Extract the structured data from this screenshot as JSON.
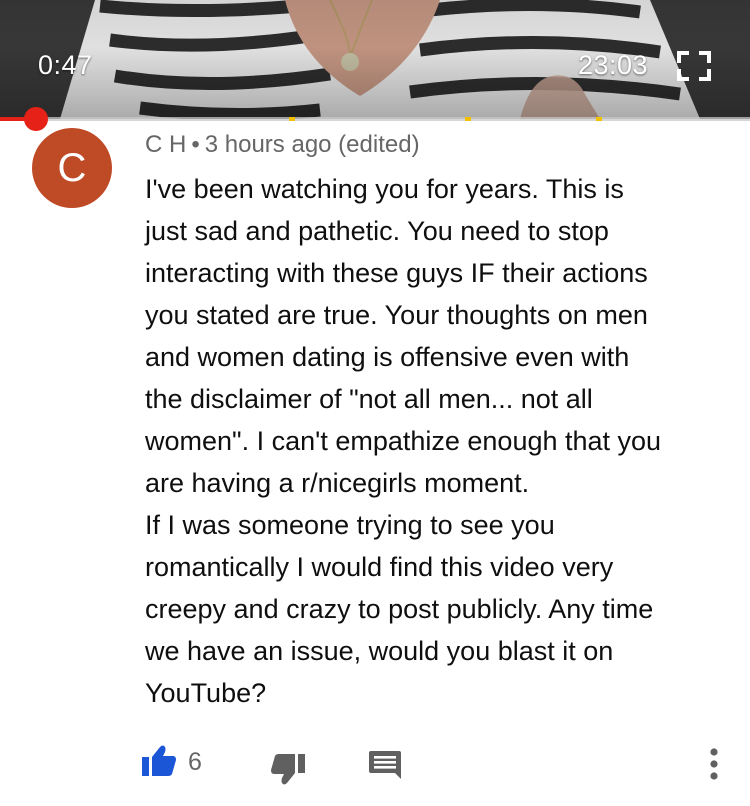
{
  "player": {
    "current_time": "0:47",
    "total_time": "23:03",
    "progress": 0.0475,
    "chapter_markers": [
      0.385,
      0.62,
      0.795
    ],
    "played_color": "#e62117",
    "marker_color": "#f2c200",
    "fullscreen_icon": "fullscreen-icon"
  },
  "comment": {
    "avatar_letter": "C",
    "avatar_color": "#bf4a26",
    "author": "C H",
    "separator": "•",
    "timestamp": "3 hours ago (edited)",
    "body_lines": [
      "I've been watching you for years. This is",
      "just sad and pathetic. You need to stop",
      "interacting with these guys IF their actions",
      "you stated are true.  Your thoughts on men",
      "and women dating is offensive even with",
      "the disclaimer of \"not all men... not all",
      "women\". I can't empathize enough that you",
      "are having a r/nicegirls moment.",
      "If I was someone trying to see you",
      "romantically I would find this video very",
      "creepy and crazy to post publicly.  Any time",
      "we have an issue, would you blast it on",
      "YouTube?"
    ]
  },
  "actions": {
    "like_icon": "thumbs-up-icon",
    "like_color": "#1a56d6",
    "like_count": "6",
    "dislike_icon": "thumbs-down-icon",
    "reply_icon": "comment-icon",
    "more_icon": "more-vertical-icon"
  }
}
